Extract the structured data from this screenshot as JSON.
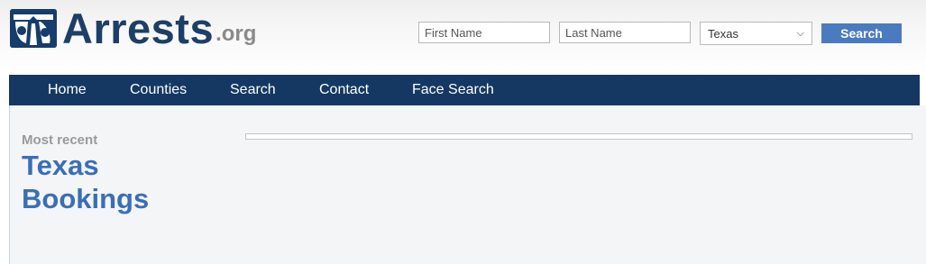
{
  "brand": {
    "name": "Arrests",
    "tld": ".org",
    "primary_color": "#1d3f66",
    "tld_color": "#8a8a8a"
  },
  "search": {
    "first_name_placeholder": "First Name",
    "last_name_placeholder": "Last Name",
    "state_selected": "Texas",
    "button_label": "Search",
    "button_color": "#4a7bc0"
  },
  "nav": {
    "background": "#143862",
    "items": [
      {
        "label": "Home"
      },
      {
        "label": "Counties"
      },
      {
        "label": "Search"
      },
      {
        "label": "Contact"
      },
      {
        "label": "Face Search"
      }
    ]
  },
  "main": {
    "subheading": "Most recent",
    "title": "Texas Bookings",
    "title_color": "#3a6fb6"
  }
}
